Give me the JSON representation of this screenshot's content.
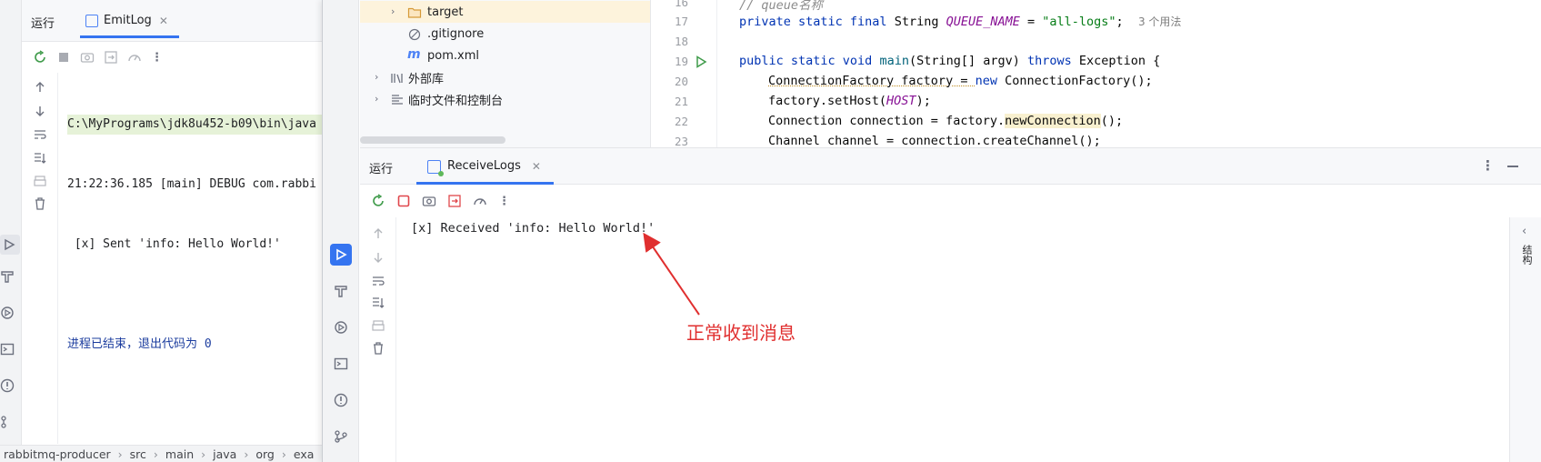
{
  "left_window": {
    "run_label": "运行",
    "tab_label": "EmitLog",
    "console_lines": [
      "C:\\MyPrograms\\jdk8u452-b09\\bin\\java",
      "21:22:36.185 [main] DEBUG com.rabbi",
      " [x] Sent 'info: Hello World!'",
      "",
      "进程已结束，退出代码为 0"
    ],
    "breadcrumb": [
      "rabbitmq-producer",
      "src",
      "main",
      "java",
      "org",
      "exa"
    ]
  },
  "project_tree": {
    "items": [
      {
        "label": "target",
        "type": "folder",
        "expandable": true,
        "selected": true
      },
      {
        "label": ".gitignore",
        "type": "ignore-file",
        "expandable": false,
        "selected": false
      },
      {
        "label": "pom.xml",
        "type": "maven-file",
        "expandable": false,
        "selected": false
      },
      {
        "label": "外部库",
        "type": "library",
        "expandable": true,
        "selected": false
      },
      {
        "label": "临时文件和控制台",
        "type": "scratches",
        "expandable": true,
        "selected": false
      }
    ]
  },
  "editor": {
    "line_numbers": [
      "16",
      "17",
      "18",
      "19",
      "20",
      "21",
      "22",
      "23"
    ],
    "line16_comment": "// queue名称",
    "line17": {
      "kw": "private static final",
      "type": " String ",
      "name": "QUEUE_NAME",
      "eq": " = ",
      "value": "\"all-logs\"",
      "end": ";",
      "usages": "3 个用法"
    },
    "line19": {
      "kw1": "public static void ",
      "method": "main",
      "params": "(String[] argv) ",
      "kw2": "throws",
      "rest": " Exception {"
    },
    "line20": {
      "pre": "ConnectionFactory factory = ",
      "kw": "new",
      "post": " ConnectionFactory();"
    },
    "line21": {
      "pre": "factory.setHost(",
      "const": "HOST",
      "post": ");"
    },
    "line22": {
      "pre": "Connection connection = factory.",
      "call": "newConnection",
      "post": "();"
    },
    "line23": "Channel channel = connection.createChannel();"
  },
  "run_window": {
    "run_label": "运行",
    "tab_label": "ReceiveLogs",
    "console_output": "[x] Received 'info: Hello World!'"
  },
  "annotation": {
    "text": "正常收到消息",
    "color": "#e02f2f"
  },
  "right_strip": {
    "label": "结构"
  },
  "colors": {
    "accent": "#3574f0",
    "run_green": "#5fb85a",
    "stop_red": "#e0474c"
  }
}
